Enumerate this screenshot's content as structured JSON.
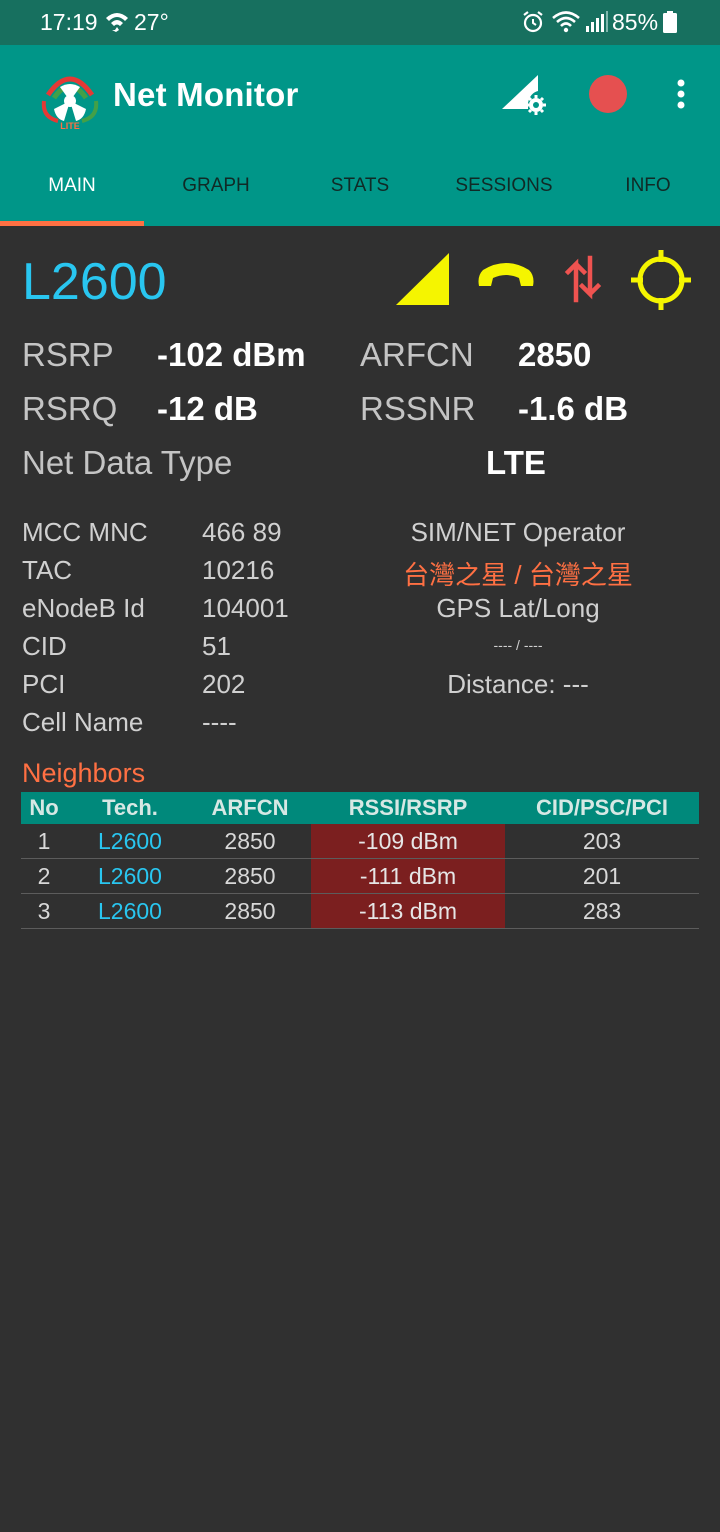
{
  "status_bar": {
    "time": "17:19",
    "temperature": "27°",
    "battery": "85%",
    "icons": [
      "wifi-calling-icon",
      "alarm-icon",
      "wifi-icon",
      "cell-signal-icon",
      "battery-icon"
    ]
  },
  "app_bar": {
    "title": "Net Monitor",
    "logo_badge": "LITE",
    "actions": [
      "signal-settings-icon",
      "record-icon",
      "overflow-menu-icon"
    ]
  },
  "tabs": [
    {
      "label": "MAIN",
      "active": true
    },
    {
      "label": "GRAPH",
      "active": false
    },
    {
      "label": "STATS",
      "active": false
    },
    {
      "label": "SESSIONS",
      "active": false
    },
    {
      "label": "INFO",
      "active": false
    }
  ],
  "main": {
    "technology": "L2600",
    "indicators": [
      "signal-strength-icon",
      "phone-idle-icon",
      "data-activity-icon",
      "gps-crosshair-icon"
    ],
    "metrics": {
      "rsrp_label": "RSRP",
      "rsrp_value": "-102 dBm",
      "arfcn_label": "ARFCN",
      "arfcn_value": "2850",
      "rsrq_label": "RSRQ",
      "rsrq_value": "-12 dB",
      "rssnr_label": "RSSNR",
      "rssnr_value": "-1.6 dB",
      "net_data_type_label": "Net Data Type",
      "net_data_type_value": "LTE"
    },
    "cell_info": [
      {
        "label": "MCC MNC",
        "value": "466 89"
      },
      {
        "label": "TAC",
        "value": "10216"
      },
      {
        "label": "eNodeB Id",
        "value": "104001"
      },
      {
        "label": "CID",
        "value": "51"
      },
      {
        "label": "PCI",
        "value": "202"
      },
      {
        "label": "Cell Name",
        "value": "----"
      }
    ],
    "operator": {
      "label": "SIM/NET Operator",
      "value": "台灣之星 / 台灣之星",
      "gps_label": "GPS Lat/Long",
      "gps_value": "---- / ----",
      "distance": "Distance: ---"
    }
  },
  "neighbors": {
    "title": "Neighbors",
    "headers": [
      "No",
      "Tech.",
      "ARFCN",
      "RSSI/RSRP",
      "CID/PSC/PCI"
    ],
    "rows": [
      {
        "no": "1",
        "tech": "L2600",
        "arfcn": "2850",
        "rsrp": "-109 dBm",
        "cid": "203"
      },
      {
        "no": "2",
        "tech": "L2600",
        "arfcn": "2850",
        "rsrp": "-111 dBm",
        "cid": "201"
      },
      {
        "no": "3",
        "tech": "L2600",
        "arfcn": "2850",
        "rsrp": "-113 dBm",
        "cid": "283"
      }
    ]
  },
  "colors": {
    "status_bar": "#17705f",
    "app_bar": "#009688",
    "tab_indicator": "#ff7043",
    "background": "#303030",
    "tech_blue": "#29c6f0",
    "indicator_yellow": "#f5f500",
    "data_red": "#ef5350",
    "operator_orange": "#ff7043",
    "rsrp_cell_bg": "#7b1f1f"
  }
}
